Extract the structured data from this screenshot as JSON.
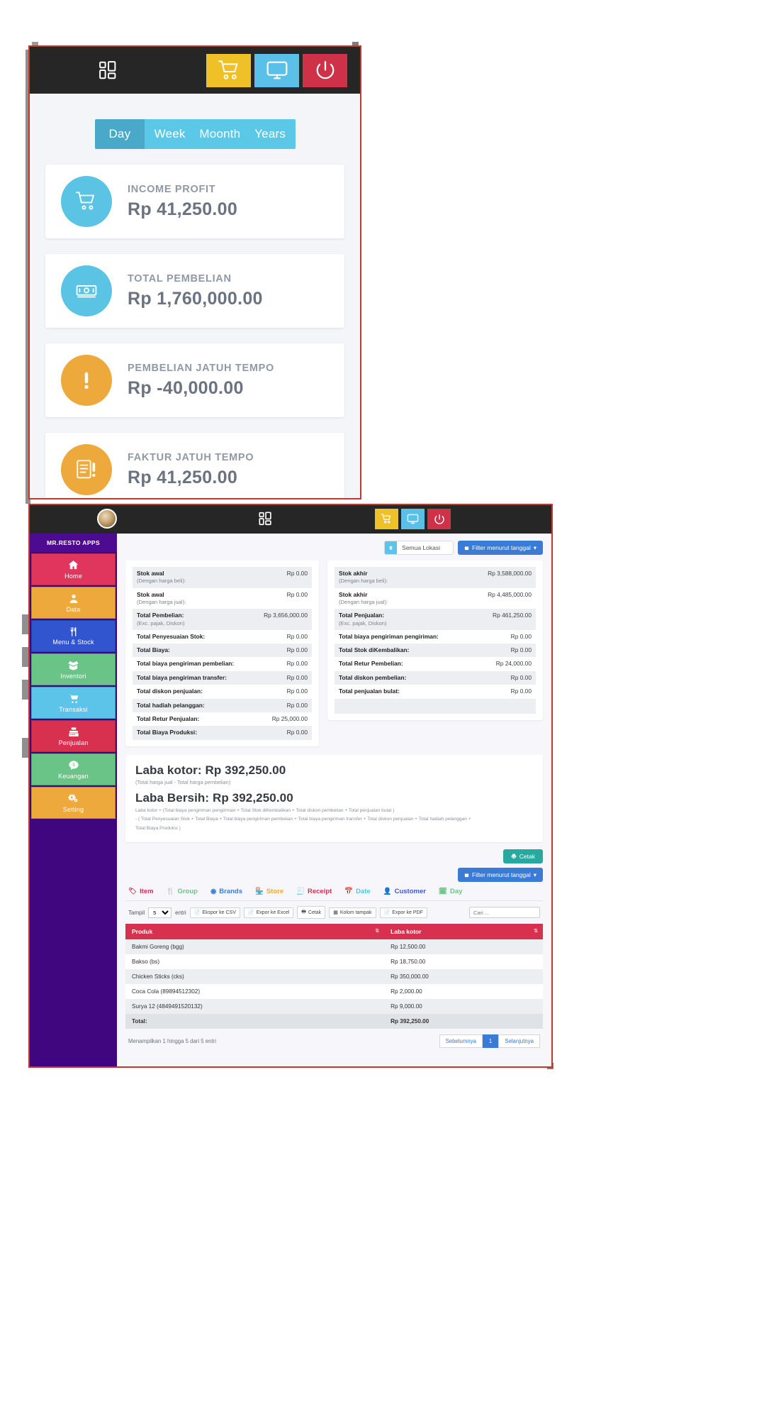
{
  "window_top": {
    "topbar": {
      "grid_icon": "grid-icon",
      "actions": [
        {
          "name": "cart-button",
          "icon": "shopping-cart-icon",
          "color": "#f0c029"
        },
        {
          "name": "display-button",
          "icon": "monitor-icon",
          "color": "#5bc0e8"
        },
        {
          "name": "power-button",
          "icon": "power-icon",
          "color": "#cf3149"
        }
      ]
    },
    "segments": [
      {
        "label": "Day",
        "active": true
      },
      {
        "label": "Week",
        "active": false
      },
      {
        "label": "Moonth",
        "active": false
      },
      {
        "label": "Years",
        "active": false
      }
    ],
    "cards": [
      {
        "label": "INCOME PROFIT",
        "value": "Rp 41,250.00",
        "icon": "shopping-cart-icon",
        "color": "#5bc4e4"
      },
      {
        "label": "TOTAL PEMBELIAN",
        "value": "Rp 1,760,000.00",
        "icon": "money-bill-icon",
        "color": "#5bc4e4"
      },
      {
        "label": "PEMBELIAN JATUH TEMPO",
        "value": "Rp -40,000.00",
        "icon": "exclamation-icon",
        "color": "#eda93c"
      },
      {
        "label": "FAKTUR JATUH TEMPO",
        "value": "Rp 41,250.00",
        "icon": "invoice-alert-icon",
        "color": "#eda93c"
      }
    ]
  },
  "window_bottom": {
    "topbar": {
      "avatar": "user-avatar",
      "grid_icon": "grid-icon",
      "actions": [
        {
          "name": "cart-button",
          "icon": "shopping-cart-icon"
        },
        {
          "name": "display-button",
          "icon": "monitor-icon"
        },
        {
          "name": "power-button",
          "icon": "power-icon"
        }
      ]
    },
    "sidebar": {
      "brand": "MR.RESTO APPS",
      "items": [
        {
          "label": "Home",
          "icon": "home-icon",
          "color": "#e0365e"
        },
        {
          "label": "Data",
          "icon": "user-icon",
          "color": "#eda93c"
        },
        {
          "label": "Menu & Stock",
          "icon": "cutlery-icon",
          "color": "#3055cf"
        },
        {
          "label": "Inventori",
          "icon": "box-open-icon",
          "color": "#6bc487"
        },
        {
          "label": "Transaksi",
          "icon": "shopping-cart-icon",
          "color": "#5bc4e8"
        },
        {
          "label": "Penjualan",
          "icon": "cash-register-icon",
          "color": "#d8304f"
        },
        {
          "label": "Keuangan",
          "icon": "money-chat-icon",
          "color": "#6bc487"
        },
        {
          "label": "Setting",
          "icon": "gears-icon",
          "color": "#eda93c"
        }
      ]
    },
    "toolbar": {
      "location_label": "Semua Lokasi",
      "location_icon": "map-pin-icon",
      "filter_label": "Filter menurut tanggal",
      "filter_icon": "calendar-icon"
    },
    "report_left": [
      {
        "key": "Stok awal",
        "sub": "(Dengan harga beli):",
        "value": "Rp 0.00"
      },
      {
        "key": "Stok awal",
        "sub": "(Dengan harga jual):",
        "value": "Rp 0.00"
      },
      {
        "key": "Total Pembelian:",
        "sub": "(Exc. pajak, Diskon)",
        "value": "Rp 3,656,000.00"
      },
      {
        "key": "Total Penyesuaian Stok:",
        "sub": "",
        "value": "Rp 0.00"
      },
      {
        "key": "Total Biaya:",
        "sub": "",
        "value": "Rp 0.00"
      },
      {
        "key": "Total biaya pengiriman pembelian:",
        "sub": "",
        "value": "Rp 0.00"
      },
      {
        "key": "Total biaya pengiriman transfer:",
        "sub": "",
        "value": "Rp 0.00"
      },
      {
        "key": "Total diskon penjualan:",
        "sub": "",
        "value": "Rp 0.00"
      },
      {
        "key": "Total hadiah pelanggan:",
        "sub": "",
        "value": "Rp 0.00"
      },
      {
        "key": "Total Retur Penjualan:",
        "sub": "",
        "value": "Rp 25,000.00"
      },
      {
        "key": "Total Biaya Produksi:",
        "sub": "",
        "value": "Rp 0.00"
      }
    ],
    "report_right": [
      {
        "key": "Stok akhir",
        "sub": "(Dengan harga beli):",
        "value": "Rp 3,588,000.00"
      },
      {
        "key": "Stok akhir",
        "sub": "(Dengan harga jual):",
        "value": "Rp 4,485,000.00"
      },
      {
        "key": "Total Penjualan:",
        "sub": "(Exc. pajak, Diskon)",
        "value": "Rp 461,250.00"
      },
      {
        "key": "Total biaya pengiriman pengiriman:",
        "sub": "",
        "value": "Rp 0.00"
      },
      {
        "key": "Total Stok diKembalikan:",
        "sub": "",
        "value": "Rp 0.00"
      },
      {
        "key": "Total Retur Pembelian:",
        "sub": "",
        "value": "Rp 24,000.00"
      },
      {
        "key": "Total diskon pembelian:",
        "sub": "",
        "value": "Rp 0.00"
      },
      {
        "key": "Total penjualan bulat:",
        "sub": "",
        "value": "Rp 0.00"
      },
      {
        "key": "",
        "sub": "",
        "value": ""
      }
    ],
    "profit": {
      "gross_title": "Laba kotor: Rp 392,250.00",
      "gross_note": "(Total harga jual - Total harga pembelian)",
      "net_title": "Laba Bersih: Rp 392,250.00",
      "net_formula_line1": "Laba kotor + (Total biaya pengiriman pengiriman + Total Stok diKembalikan + Total diskon pembelian + Total penjualan bulat )",
      "net_formula_line2": "- ( Total Penyesuaian Stok + Total Biaya + Total biaya pengiriman pembelian + Total biaya pengiriman transfer + Total diskon penjualan + Total hadiah pelanggan +",
      "net_formula_line3": "Total Biaya Produksi )"
    },
    "print_button": {
      "label": "Cetak",
      "icon": "printer-icon"
    },
    "filter_button2": {
      "label": "Filter menurut tanggal",
      "icon": "calendar-icon"
    },
    "tabs": [
      {
        "label": "Item",
        "icon": "tag-icon"
      },
      {
        "label": "Group",
        "icon": "cutlery-icon"
      },
      {
        "label": "Brands",
        "icon": "brand-icon"
      },
      {
        "label": "Store",
        "icon": "store-icon"
      },
      {
        "label": "Receipt",
        "icon": "receipt-icon"
      },
      {
        "label": "Date",
        "icon": "calendar-icon"
      },
      {
        "label": "Customer",
        "icon": "user-icon"
      },
      {
        "label": "Day",
        "icon": "calendar-day-icon"
      }
    ],
    "datatable_controls": {
      "show_label": "Tampil",
      "show_value": "5",
      "entries_label": "entri",
      "buttons": [
        {
          "label": "Ekspor ke CSV",
          "icon": "file-icon"
        },
        {
          "label": "Expor ke Excel",
          "icon": "file-icon"
        },
        {
          "label": "Cetak",
          "icon": "printer-icon"
        },
        {
          "label": "Kolom tampak",
          "icon": "columns-icon"
        },
        {
          "label": "Expor ke PDF",
          "icon": "file-icon"
        }
      ],
      "search_placeholder": "Cari ..."
    },
    "table": {
      "columns": [
        "Produk",
        "Laba kotor"
      ],
      "rows": [
        {
          "produk": "Bakmi Goreng (bgg)",
          "laba": "Rp 12,500.00"
        },
        {
          "produk": "Bakso (bs)",
          "laba": "Rp 18,750.00"
        },
        {
          "produk": "Chicken Sticks (cks)",
          "laba": "Rp 350,000.00"
        },
        {
          "produk": "Coca Cola (89894512302)",
          "laba": "Rp 2,000.00"
        },
        {
          "produk": "Surya 12 (4849491520132)",
          "laba": "Rp 9,000.00"
        }
      ],
      "total_label": "Total:",
      "total_value": "Rp 392,250.00"
    },
    "footer": {
      "info": "Menampilkan 1 hingga 5 dari 5 entri",
      "prev": "Sebelumnya",
      "current": "1",
      "next": "Selanjutnya"
    }
  }
}
